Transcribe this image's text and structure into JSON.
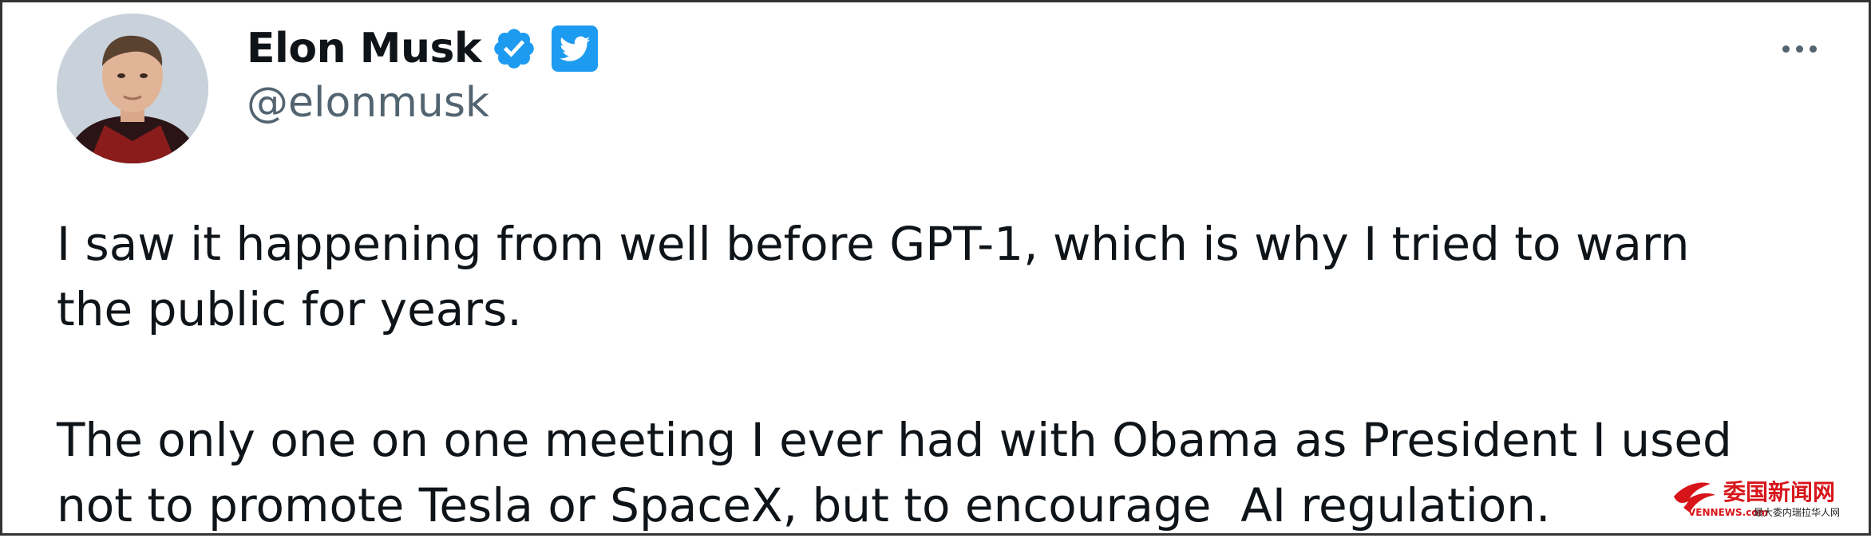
{
  "author": {
    "name": "Elon Musk",
    "handle": "@elonmusk",
    "verified_icon": "verified-check-icon",
    "platform_icon": "twitter-bird-icon"
  },
  "menu": {
    "icon": "more-options-icon"
  },
  "tweet": {
    "paragraphs": [
      "I saw it happening from well before GPT-1, which is why I tried to warn\nthe public for years.",
      "The only one on one meeting I ever had with Obama as President I used\nnot to promote Tesla or SpaceX, but to encourage  AI regulation."
    ]
  },
  "watermark": {
    "title": "委国新闻网",
    "site": "VENNEWS.com",
    "tagline": "最大委内瑞拉华人网"
  },
  "colors": {
    "verified": "#1d9bf0",
    "twitter_blue": "#1d9bf0",
    "text": "#0f1419",
    "muted": "#536471",
    "watermark_red": "#d7141a"
  }
}
